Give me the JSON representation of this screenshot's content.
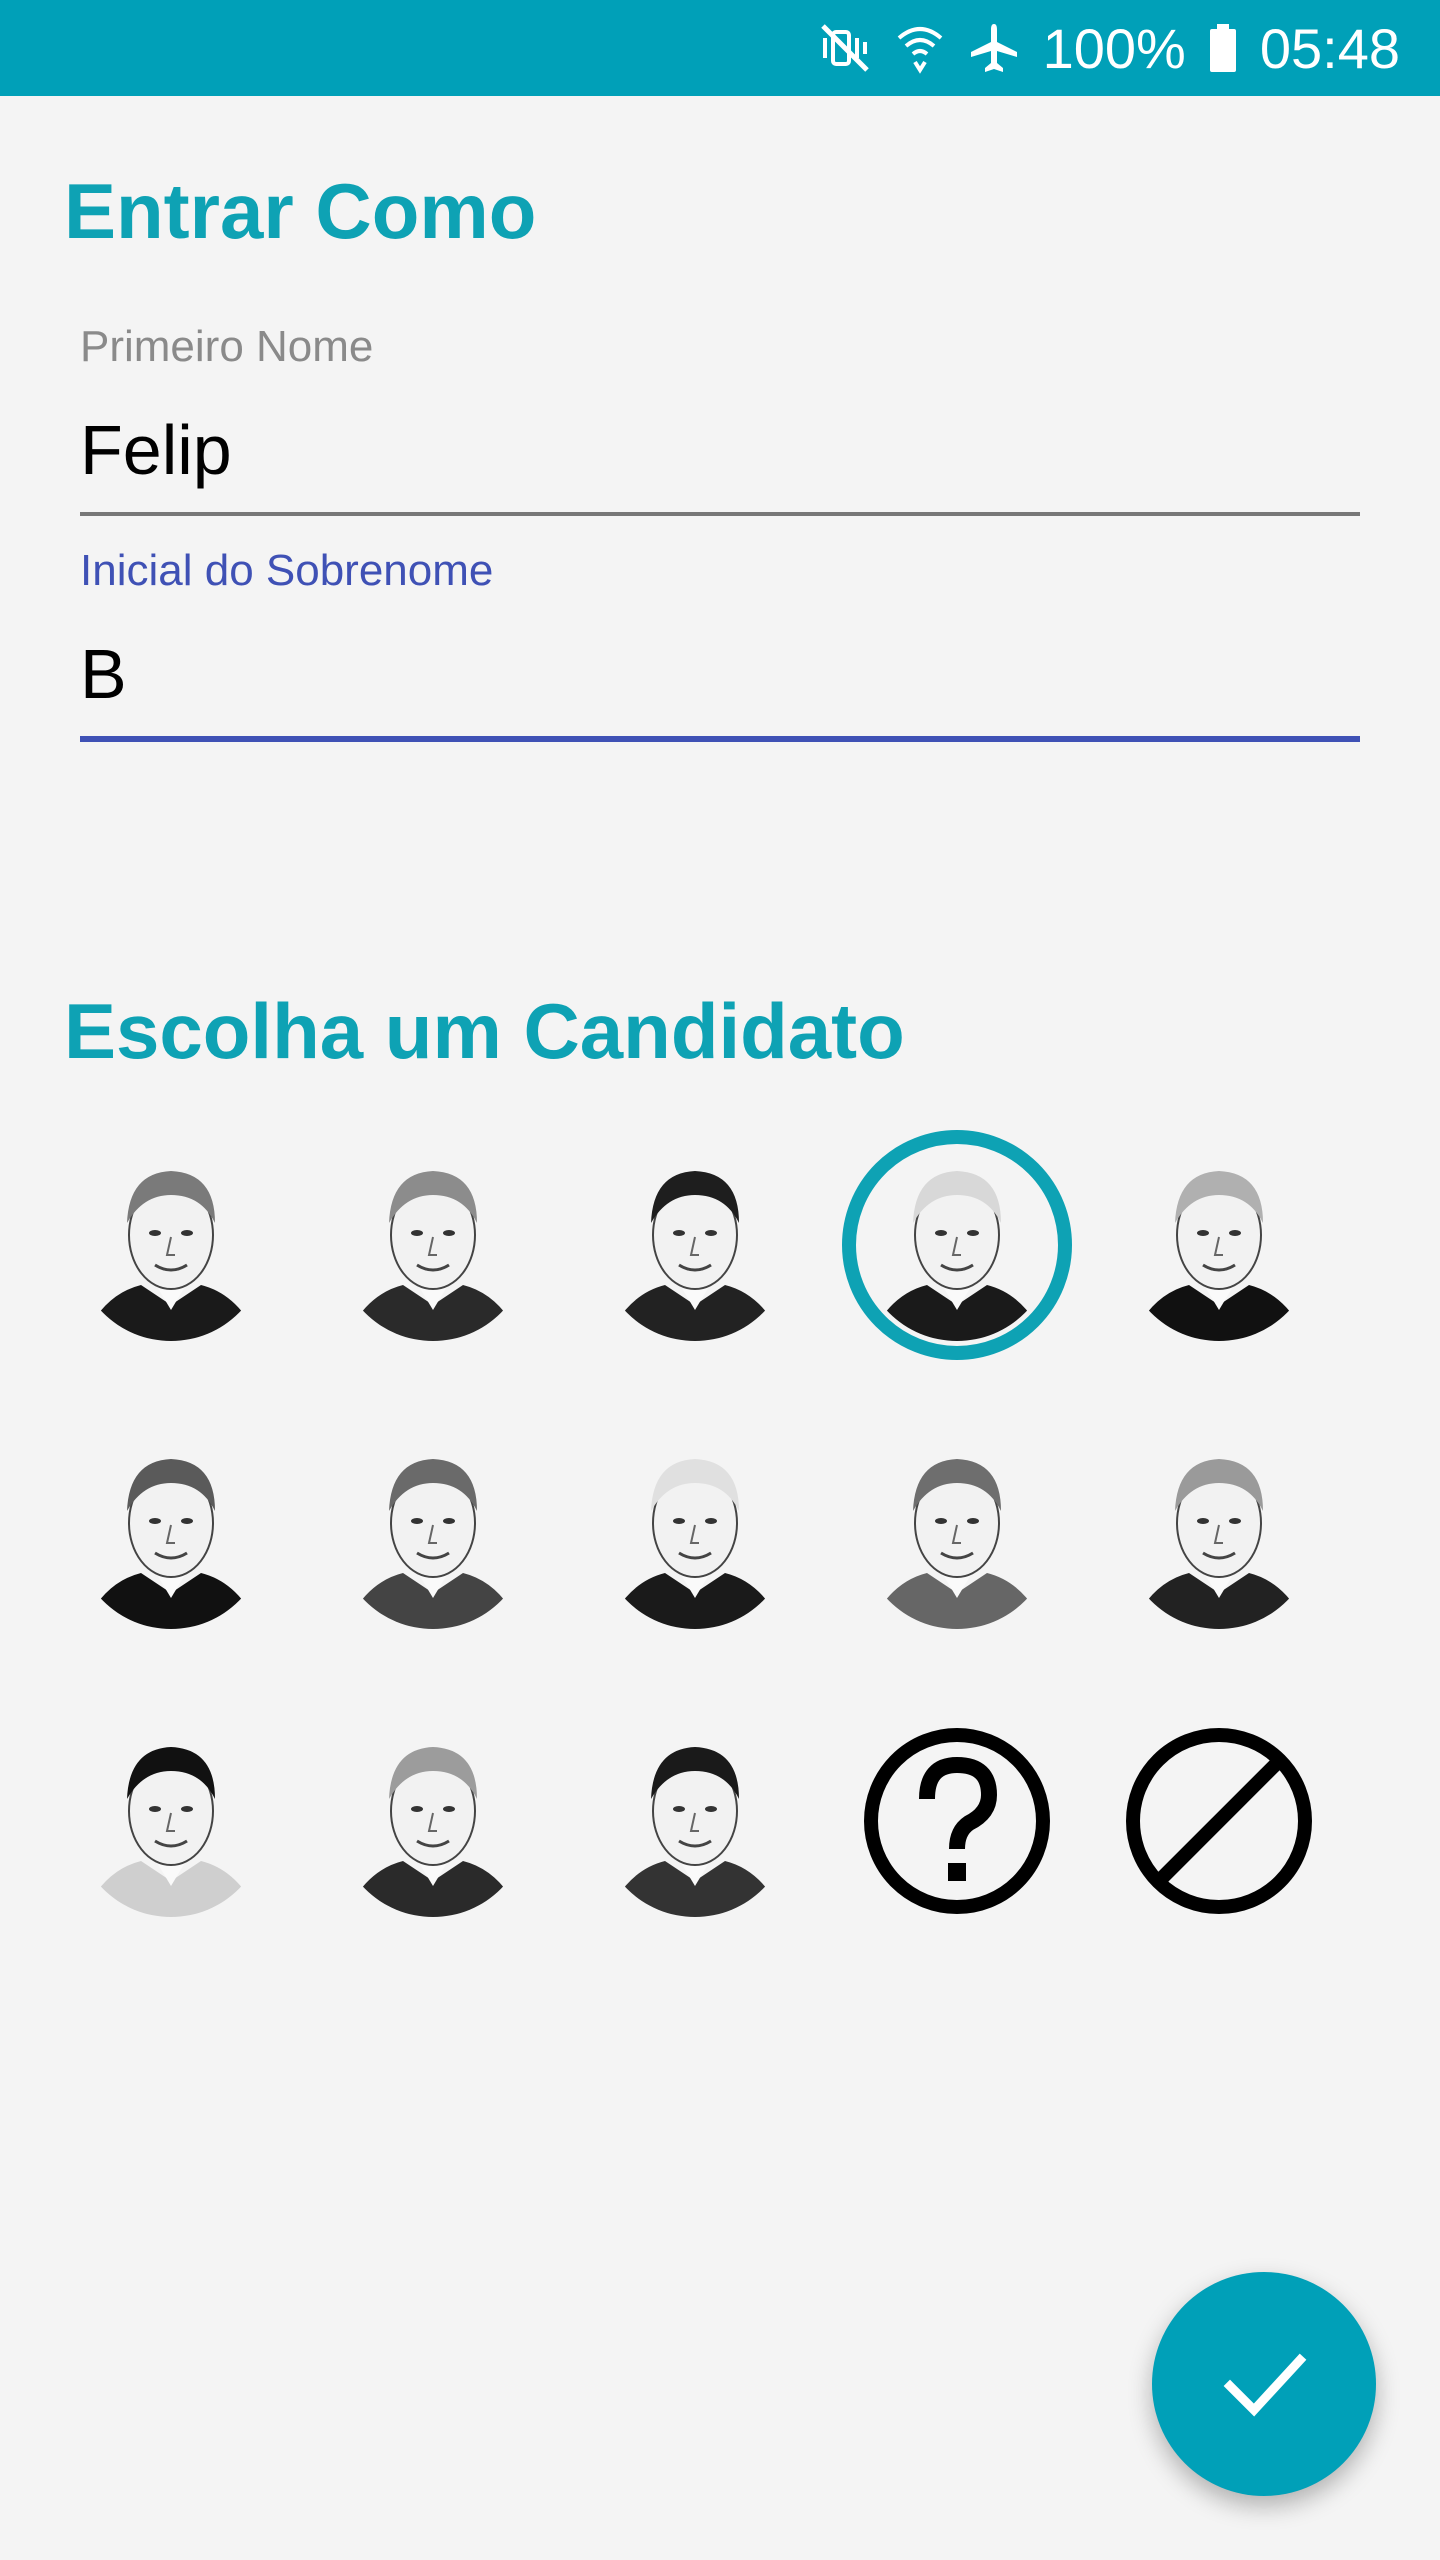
{
  "status_bar": {
    "battery_percent": "100%",
    "time": "05:48",
    "icons": [
      "mute-vibrate-icon",
      "wifi-icon",
      "airplane-mode-icon",
      "battery-icon"
    ]
  },
  "login_section": {
    "title": "Entrar Como",
    "first_name": {
      "label": "Primeiro Nome",
      "value": "Felip"
    },
    "last_initial": {
      "label": "Inicial do Sobrenome",
      "value": "B"
    }
  },
  "candidates_section": {
    "title": "Escolha um Candidato",
    "selected_index": 3,
    "options": [
      {
        "icon": "candidate-portrait-1"
      },
      {
        "icon": "candidate-portrait-2"
      },
      {
        "icon": "candidate-portrait-3"
      },
      {
        "icon": "candidate-portrait-4"
      },
      {
        "icon": "candidate-portrait-5"
      },
      {
        "icon": "candidate-portrait-6"
      },
      {
        "icon": "candidate-portrait-7"
      },
      {
        "icon": "candidate-portrait-8"
      },
      {
        "icon": "candidate-portrait-9"
      },
      {
        "icon": "candidate-portrait-10"
      },
      {
        "icon": "candidate-portrait-11"
      },
      {
        "icon": "candidate-portrait-12"
      },
      {
        "icon": "candidate-portrait-13"
      },
      {
        "icon": "question-mark-icon"
      },
      {
        "icon": "no-entry-icon"
      }
    ]
  },
  "fab": {
    "icon": "check-icon"
  },
  "colors": {
    "accent": "#0ea2b4",
    "status_bar": "#00a0b8",
    "focus": "#3f51b5",
    "background": "#f4f4f4"
  }
}
